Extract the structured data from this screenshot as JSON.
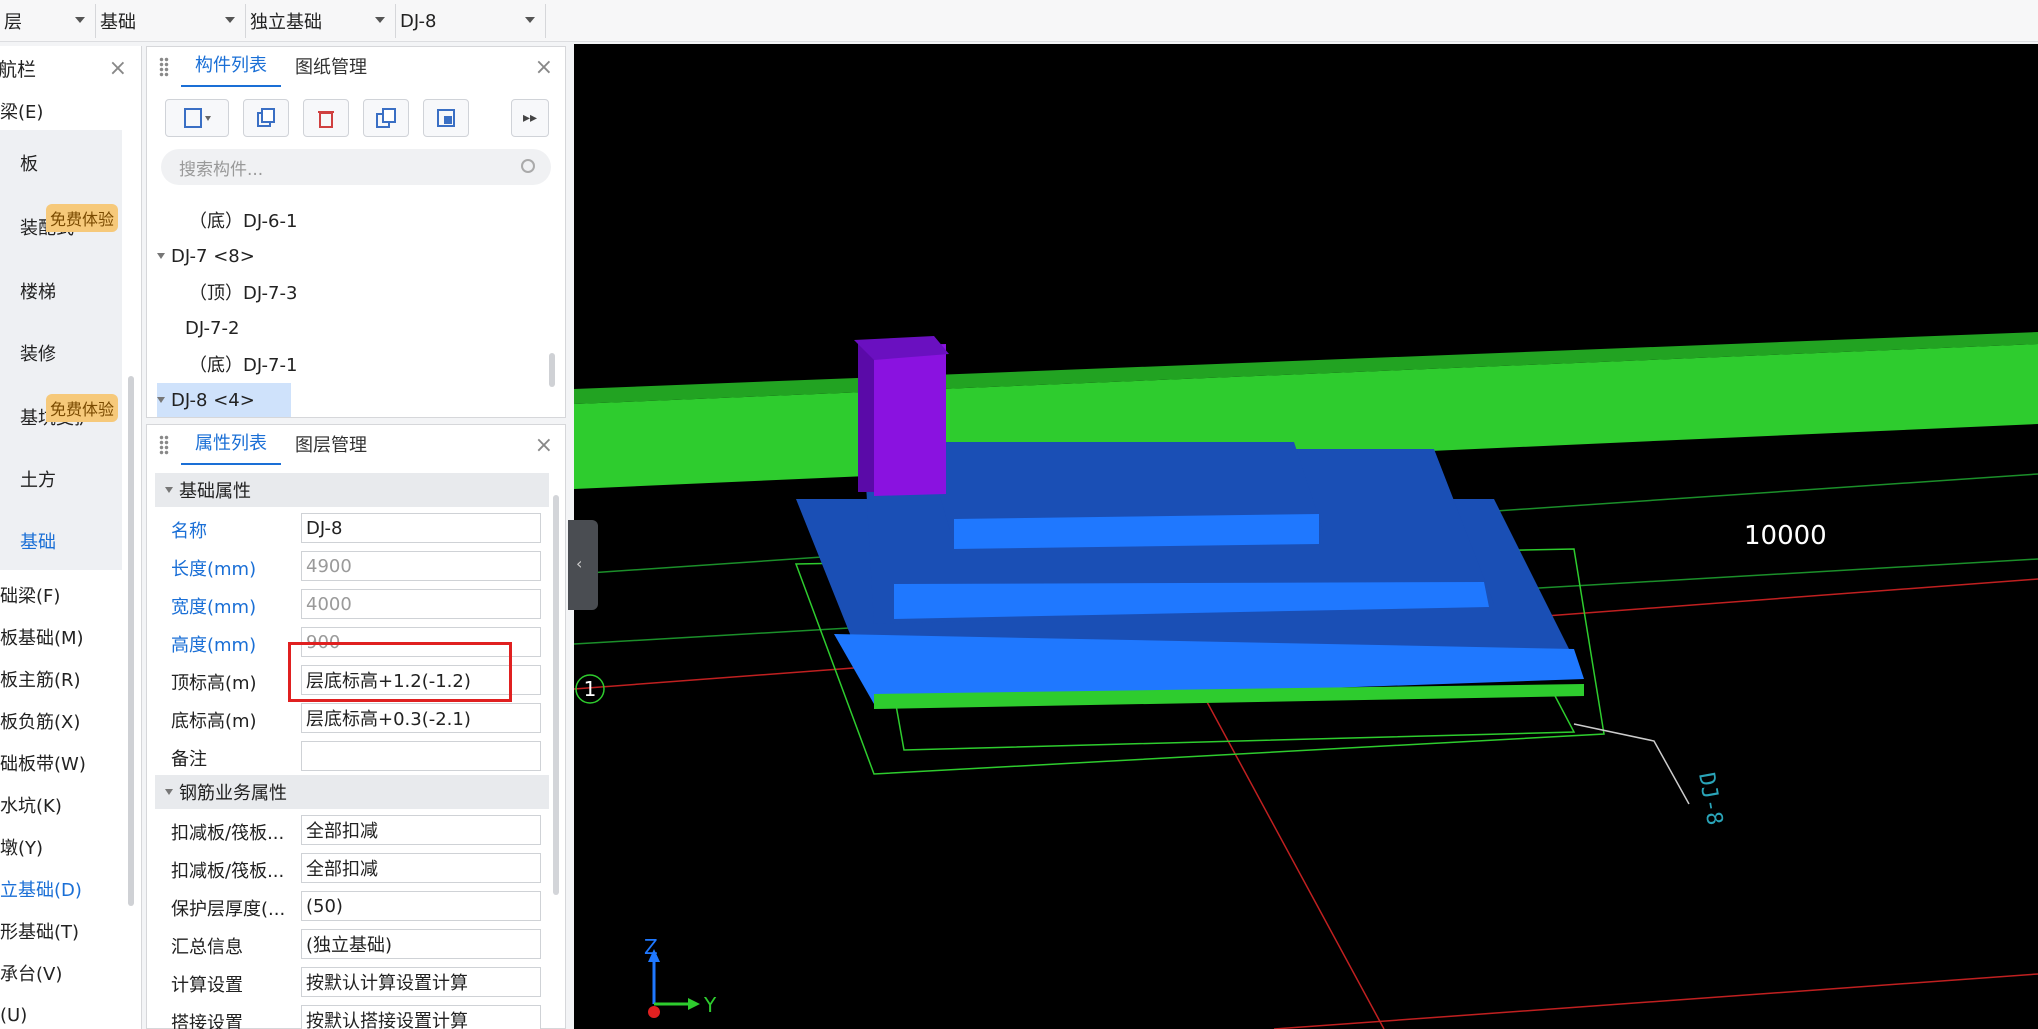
{
  "topbar": {
    "combo1": "层",
    "combo2": "基础",
    "combo3": "独立基础",
    "combo4": "DJ-8"
  },
  "nav": {
    "title": "航栏",
    "items": [
      {
        "label": "梁(E)"
      },
      {
        "label": "板"
      },
      {
        "label": "装配式"
      },
      {
        "label": "楼梯"
      },
      {
        "label": "装修"
      },
      {
        "label": "基坑支护"
      },
      {
        "label": "土方"
      },
      {
        "label": "基础"
      },
      {
        "label": "础梁(F)"
      },
      {
        "label": "板基础(M)"
      },
      {
        "label": "板主筋(R)"
      },
      {
        "label": "板负筋(X)"
      },
      {
        "label": "础板带(W)"
      },
      {
        "label": "水坑(K)"
      },
      {
        "label": "墩(Y)"
      },
      {
        "label": "立基础(D)"
      },
      {
        "label": "形基础(T)"
      },
      {
        "label": "承台(V)"
      },
      {
        "label": "(U)"
      }
    ],
    "badge": "免费体验"
  },
  "complist": {
    "tab_active": "构件列表",
    "tab_other": "图纸管理",
    "search_placeholder": "搜索构件...",
    "tree": [
      {
        "label": "（底）DJ-6-1",
        "level": 2
      },
      {
        "label": "DJ-7  <8>",
        "level": 0
      },
      {
        "label": "（顶）DJ-7-3",
        "level": 2
      },
      {
        "label": "DJ-7-2",
        "level": 1
      },
      {
        "label": "（底）DJ-7-1",
        "level": 2
      },
      {
        "label": "DJ-8  <4>",
        "level": 0
      }
    ]
  },
  "props": {
    "tab_active": "属性列表",
    "tab_other": "图层管理",
    "section1": "基础属性",
    "section2": "钢筋业务属性",
    "rows1": [
      {
        "label": "名称",
        "value": "DJ-8"
      },
      {
        "label": "长度(mm)",
        "value": "4900"
      },
      {
        "label": "宽度(mm)",
        "value": "4000"
      },
      {
        "label": "高度(mm)",
        "value": "900"
      },
      {
        "label": "顶标高(m)",
        "value": "层底标高+1.2(-1.2)"
      },
      {
        "label": "底标高(m)",
        "value": "层底标高+0.3(-2.1)"
      },
      {
        "label": "备注",
        "value": ""
      }
    ],
    "rows2": [
      {
        "label": "扣减板/筏板...",
        "value": "全部扣减"
      },
      {
        "label": "扣减板/筏板...",
        "value": "全部扣减"
      },
      {
        "label": "保护层厚度(...",
        "value": "(50)"
      },
      {
        "label": "汇总信息",
        "value": "(独立基础)"
      },
      {
        "label": "计算设置",
        "value": "按默认计算设置计算"
      },
      {
        "label": "搭接设置",
        "value": "按默认搭接设置计算"
      }
    ]
  },
  "viewport": {
    "dimension": "10000",
    "axis_number": "1",
    "axis_z": "Z",
    "axis_y": "Y",
    "label_dj8": "DJ-8",
    "colors": {
      "beam": "#2ecc2e",
      "column": "#8a12e0",
      "foundation_dark": "#1a4fb5",
      "foundation_light": "#1f78ff"
    }
  }
}
